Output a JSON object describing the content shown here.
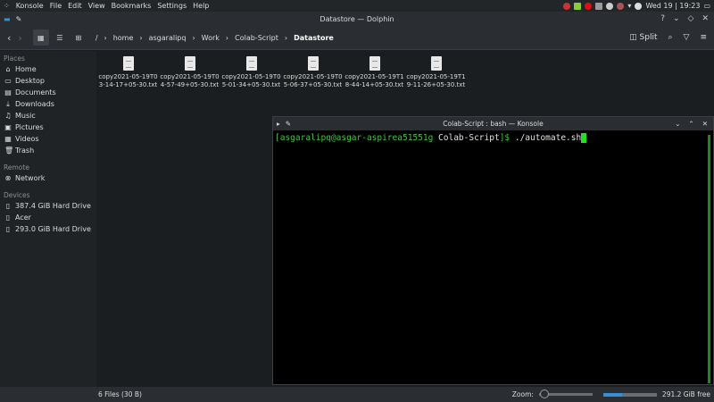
{
  "topbar": {
    "menu": [
      "Konsole",
      "File",
      "Edit",
      "View",
      "Bookmarks",
      "Settings",
      "Help"
    ],
    "clock": "Wed 19 | 19:23"
  },
  "window": {
    "title": "Datastore — Dolphin"
  },
  "breadcrumb": [
    "/",
    "home",
    "asgaralipq",
    "Work",
    "Colab-Script"
  ],
  "breadcrumb_current": "Datastore",
  "toolbar": {
    "split": "Split"
  },
  "sidebar": {
    "places_header": "Places",
    "places": [
      {
        "icon": "⌂",
        "label": "Home"
      },
      {
        "icon": "▭",
        "label": "Desktop"
      },
      {
        "icon": "▤",
        "label": "Documents"
      },
      {
        "icon": "⤓",
        "label": "Downloads"
      },
      {
        "icon": "♫",
        "label": "Music"
      },
      {
        "icon": "▣",
        "label": "Pictures"
      },
      {
        "icon": "▦",
        "label": "Videos"
      },
      {
        "icon": "🗑",
        "label": "Trash"
      }
    ],
    "remote_header": "Remote",
    "remote": [
      {
        "icon": "⊗",
        "label": "Network"
      }
    ],
    "devices_header": "Devices",
    "devices": [
      {
        "icon": "▯",
        "label": "387.4 GiB Hard Drive"
      },
      {
        "icon": "▯",
        "label": "Acer"
      },
      {
        "icon": "▯",
        "label": "293.0 GiB Hard Drive"
      }
    ]
  },
  "files": [
    "copy2021-05-19T03-14-17+05-30.txt",
    "copy2021-05-19T04-57-49+05-30.txt",
    "copy2021-05-19T05-01-34+05-30.txt",
    "copy2021-05-19T05-06-37+05-30.txt",
    "copy2021-05-19T18-44-14+05-30.txt",
    "copy2021-05-19T19-11-26+05-30.txt"
  ],
  "konsole": {
    "title": "Colab-Script : bash — Konsole",
    "prompt_user": "[asgaralipq@asgar-aspirea51551g",
    "prompt_dir": "Colab-Script",
    "prompt_end": "]$",
    "command": " ./automate.sh"
  },
  "status": {
    "summary": "6 Files (30 B)",
    "zoom_label": "Zoom:",
    "zoom_fraction": 0.05,
    "disk_used_fraction": 0.35,
    "free": "291.2 GiB free"
  },
  "colors": {
    "accent": "#3b8ecf",
    "terminal_green": "#3ec63e"
  }
}
